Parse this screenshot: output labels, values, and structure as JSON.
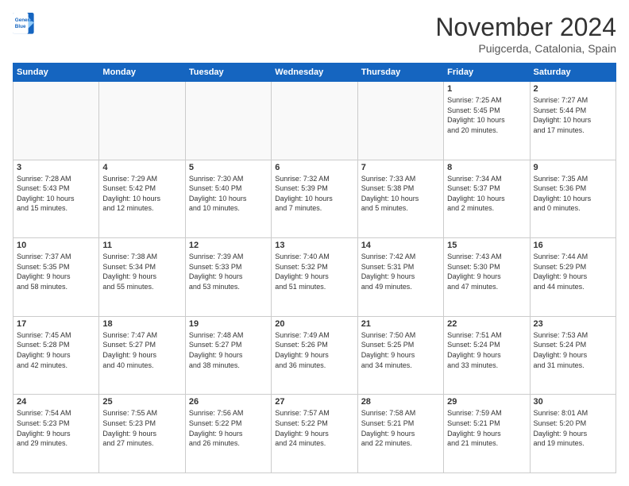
{
  "header": {
    "logo_line1": "General",
    "logo_line2": "Blue",
    "month": "November 2024",
    "location": "Puigcerda, Catalonia, Spain"
  },
  "weekdays": [
    "Sunday",
    "Monday",
    "Tuesday",
    "Wednesday",
    "Thursday",
    "Friday",
    "Saturday"
  ],
  "weeks": [
    [
      {
        "day": "",
        "info": ""
      },
      {
        "day": "",
        "info": ""
      },
      {
        "day": "",
        "info": ""
      },
      {
        "day": "",
        "info": ""
      },
      {
        "day": "",
        "info": ""
      },
      {
        "day": "1",
        "info": "Sunrise: 7:25 AM\nSunset: 5:45 PM\nDaylight: 10 hours\nand 20 minutes."
      },
      {
        "day": "2",
        "info": "Sunrise: 7:27 AM\nSunset: 5:44 PM\nDaylight: 10 hours\nand 17 minutes."
      }
    ],
    [
      {
        "day": "3",
        "info": "Sunrise: 7:28 AM\nSunset: 5:43 PM\nDaylight: 10 hours\nand 15 minutes."
      },
      {
        "day": "4",
        "info": "Sunrise: 7:29 AM\nSunset: 5:42 PM\nDaylight: 10 hours\nand 12 minutes."
      },
      {
        "day": "5",
        "info": "Sunrise: 7:30 AM\nSunset: 5:40 PM\nDaylight: 10 hours\nand 10 minutes."
      },
      {
        "day": "6",
        "info": "Sunrise: 7:32 AM\nSunset: 5:39 PM\nDaylight: 10 hours\nand 7 minutes."
      },
      {
        "day": "7",
        "info": "Sunrise: 7:33 AM\nSunset: 5:38 PM\nDaylight: 10 hours\nand 5 minutes."
      },
      {
        "day": "8",
        "info": "Sunrise: 7:34 AM\nSunset: 5:37 PM\nDaylight: 10 hours\nand 2 minutes."
      },
      {
        "day": "9",
        "info": "Sunrise: 7:35 AM\nSunset: 5:36 PM\nDaylight: 10 hours\nand 0 minutes."
      }
    ],
    [
      {
        "day": "10",
        "info": "Sunrise: 7:37 AM\nSunset: 5:35 PM\nDaylight: 9 hours\nand 58 minutes."
      },
      {
        "day": "11",
        "info": "Sunrise: 7:38 AM\nSunset: 5:34 PM\nDaylight: 9 hours\nand 55 minutes."
      },
      {
        "day": "12",
        "info": "Sunrise: 7:39 AM\nSunset: 5:33 PM\nDaylight: 9 hours\nand 53 minutes."
      },
      {
        "day": "13",
        "info": "Sunrise: 7:40 AM\nSunset: 5:32 PM\nDaylight: 9 hours\nand 51 minutes."
      },
      {
        "day": "14",
        "info": "Sunrise: 7:42 AM\nSunset: 5:31 PM\nDaylight: 9 hours\nand 49 minutes."
      },
      {
        "day": "15",
        "info": "Sunrise: 7:43 AM\nSunset: 5:30 PM\nDaylight: 9 hours\nand 47 minutes."
      },
      {
        "day": "16",
        "info": "Sunrise: 7:44 AM\nSunset: 5:29 PM\nDaylight: 9 hours\nand 44 minutes."
      }
    ],
    [
      {
        "day": "17",
        "info": "Sunrise: 7:45 AM\nSunset: 5:28 PM\nDaylight: 9 hours\nand 42 minutes."
      },
      {
        "day": "18",
        "info": "Sunrise: 7:47 AM\nSunset: 5:27 PM\nDaylight: 9 hours\nand 40 minutes."
      },
      {
        "day": "19",
        "info": "Sunrise: 7:48 AM\nSunset: 5:27 PM\nDaylight: 9 hours\nand 38 minutes."
      },
      {
        "day": "20",
        "info": "Sunrise: 7:49 AM\nSunset: 5:26 PM\nDaylight: 9 hours\nand 36 minutes."
      },
      {
        "day": "21",
        "info": "Sunrise: 7:50 AM\nSunset: 5:25 PM\nDaylight: 9 hours\nand 34 minutes."
      },
      {
        "day": "22",
        "info": "Sunrise: 7:51 AM\nSunset: 5:24 PM\nDaylight: 9 hours\nand 33 minutes."
      },
      {
        "day": "23",
        "info": "Sunrise: 7:53 AM\nSunset: 5:24 PM\nDaylight: 9 hours\nand 31 minutes."
      }
    ],
    [
      {
        "day": "24",
        "info": "Sunrise: 7:54 AM\nSunset: 5:23 PM\nDaylight: 9 hours\nand 29 minutes."
      },
      {
        "day": "25",
        "info": "Sunrise: 7:55 AM\nSunset: 5:23 PM\nDaylight: 9 hours\nand 27 minutes."
      },
      {
        "day": "26",
        "info": "Sunrise: 7:56 AM\nSunset: 5:22 PM\nDaylight: 9 hours\nand 26 minutes."
      },
      {
        "day": "27",
        "info": "Sunrise: 7:57 AM\nSunset: 5:22 PM\nDaylight: 9 hours\nand 24 minutes."
      },
      {
        "day": "28",
        "info": "Sunrise: 7:58 AM\nSunset: 5:21 PM\nDaylight: 9 hours\nand 22 minutes."
      },
      {
        "day": "29",
        "info": "Sunrise: 7:59 AM\nSunset: 5:21 PM\nDaylight: 9 hours\nand 21 minutes."
      },
      {
        "day": "30",
        "info": "Sunrise: 8:01 AM\nSunset: 5:20 PM\nDaylight: 9 hours\nand 19 minutes."
      }
    ]
  ]
}
